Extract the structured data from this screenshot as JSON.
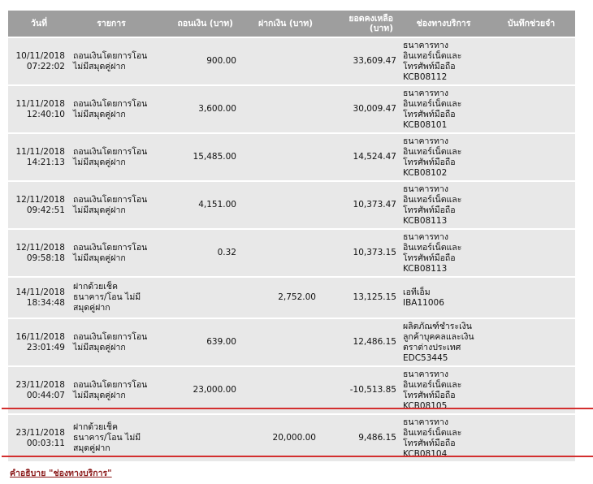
{
  "headers": {
    "date": "วันที่",
    "description": "รายการ",
    "withdraw": "ถอนเงิน (บาท)",
    "deposit": "ฝากเงิน (บาท)",
    "balance_line1": "ยอดคงเหลือ",
    "balance_line2": "(บาท)",
    "channel": "ช่องทางบริการ",
    "memo": "บันทึกช่วยจำ"
  },
  "rows": [
    {
      "date": "10/11/2018",
      "time": "07:22:02",
      "desc1": "ถอนเงินโดยการโอน",
      "desc2": "ไม่มีสมุดคู่ฝาก",
      "desc3": "",
      "withdraw": "900.00",
      "deposit": "",
      "balance": "33,609.47",
      "ch1": "ธนาคารทาง",
      "ch2": "อินเทอร์เน็ตและ",
      "ch3": "โทรศัพท์มือถือ",
      "ch4": "KCB08112",
      "memo": ""
    },
    {
      "date": "11/11/2018",
      "time": "12:40:10",
      "desc1": "ถอนเงินโดยการโอน",
      "desc2": "ไม่มีสมุดคู่ฝาก",
      "desc3": "",
      "withdraw": "3,600.00",
      "deposit": "",
      "balance": "30,009.47",
      "ch1": "ธนาคารทาง",
      "ch2": "อินเทอร์เน็ตและ",
      "ch3": "โทรศัพท์มือถือ",
      "ch4": "KCB08101",
      "memo": ""
    },
    {
      "date": "11/11/2018",
      "time": "14:21:13",
      "desc1": "ถอนเงินโดยการโอน",
      "desc2": "ไม่มีสมุดคู่ฝาก",
      "desc3": "",
      "withdraw": "15,485.00",
      "deposit": "",
      "balance": "14,524.47",
      "ch1": "ธนาคารทาง",
      "ch2": "อินเทอร์เน็ตและ",
      "ch3": "โทรศัพท์มือถือ",
      "ch4": "KCB08102",
      "memo": ""
    },
    {
      "date": "12/11/2018",
      "time": "09:42:51",
      "desc1": "ถอนเงินโดยการโอน",
      "desc2": "ไม่มีสมุดคู่ฝาก",
      "desc3": "",
      "withdraw": "4,151.00",
      "deposit": "",
      "balance": "10,373.47",
      "ch1": "ธนาคารทาง",
      "ch2": "อินเทอร์เน็ตและ",
      "ch3": "โทรศัพท์มือถือ",
      "ch4": "KCB08113",
      "memo": ""
    },
    {
      "date": "12/11/2018",
      "time": "09:58:18",
      "desc1": "ถอนเงินโดยการโอน",
      "desc2": "ไม่มีสมุดคู่ฝาก",
      "desc3": "",
      "withdraw": "0.32",
      "deposit": "",
      "balance": "10,373.15",
      "ch1": "ธนาคารทาง",
      "ch2": "อินเทอร์เน็ตและ",
      "ch3": "โทรศัพท์มือถือ",
      "ch4": "KCB08113",
      "memo": ""
    },
    {
      "date": "14/11/2018",
      "time": "18:34:48",
      "desc1": "ฝากด้วยเช็ค",
      "desc2": "ธนาคาร/โอน ไม่มี",
      "desc3": "สมุดคู่ฝาก",
      "withdraw": "",
      "deposit": "2,752.00",
      "balance": "13,125.15",
      "ch1": "เอทีเอ็ม",
      "ch2": "IBA11006",
      "ch3": "",
      "ch4": "",
      "memo": ""
    },
    {
      "date": "16/11/2018",
      "time": "23:01:49",
      "desc1": "ถอนเงินโดยการโอน",
      "desc2": "ไม่มีสมุดคู่ฝาก",
      "desc3": "",
      "withdraw": "639.00",
      "deposit": "",
      "balance": "12,486.15",
      "ch1": "ผลิตภัณฑ์ชำระเงิน",
      "ch2": "ลูกค้าบุคคลและเงิน",
      "ch3": "ตราต่างประเทศ",
      "ch4": "EDC53445",
      "memo": ""
    },
    {
      "date": "23/11/2018",
      "time": "00:44:07",
      "desc1": "ถอนเงินโดยการโอน",
      "desc2": "ไม่มีสมุดคู่ฝาก",
      "desc3": "",
      "withdraw": "23,000.00",
      "deposit": "",
      "balance": "-10,513.85",
      "ch1": "ธนาคารทาง",
      "ch2": "อินเทอร์เน็ตและ",
      "ch3": "โทรศัพท์มือถือ",
      "ch4": "KCB08105",
      "memo": ""
    },
    {
      "date": "23/11/2018",
      "time": "00:03:11",
      "desc1": "ฝากด้วยเช็ค",
      "desc2": "ธนาคาร/โอน ไม่มี",
      "desc3": "สมุดคู่ฝาก",
      "withdraw": "",
      "deposit": "20,000.00",
      "balance": "9,486.15",
      "ch1": "ธนาคารทาง",
      "ch2": "อินเทอร์เน็ตและ",
      "ch3": "โทรศัพท์มือถือ",
      "ch4": "KCB08104",
      "memo": ""
    }
  ],
  "footer": {
    "link": "คำอธิบาย \"ช่องทางบริการ\""
  },
  "colors": {
    "header_bg": "#9e9e9e",
    "row_bg": "#e8e8e8",
    "highlight_line": "#d32f2f"
  }
}
